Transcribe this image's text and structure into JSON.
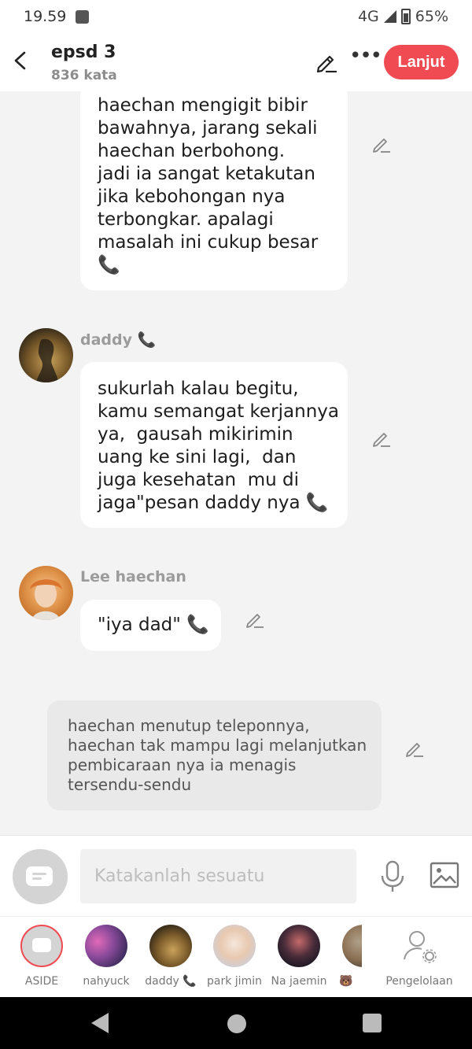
{
  "status_bar": {
    "time": "19.59",
    "network": "4G",
    "battery": "65%"
  },
  "header": {
    "title": "epsd 3",
    "word_count": "836 kata",
    "next_label": "Lanjut"
  },
  "messages": [
    {
      "lines": [
        "haechan mengigit bibir",
        "bawahnya, jarang sekali",
        "haechan berbohong.",
        "jadi ia sangat ketakutan",
        "jika kebohongan nya",
        "terbongkar. apalagi",
        "masalah ini cukup besar"
      ],
      "phone": "📞"
    },
    {
      "sender": "daddy",
      "sender_phone": "📞",
      "lines": [
        "sukurlah kalau begitu,",
        "kamu semangat kerjannya",
        "ya,  gausah mikirimin",
        "uang ke sini lagi,  dan",
        "juga kesehatan  mu di",
        "jaga\"pesan daddy nya"
      ],
      "phone": "📞"
    },
    {
      "sender": "Lee haechan",
      "lines": [
        "\"iya dad\""
      ],
      "phone": "📞"
    }
  ],
  "narration": {
    "lines": [
      "haechan menutup teleponnya,",
      "haechan tak mampu lagi melanjutkan",
      "pembicaraan nya ia menagis",
      "tersendu-sendu"
    ]
  },
  "input": {
    "placeholder": "Katakanlah sesuatu"
  },
  "characters": [
    {
      "label": "ASIDE"
    },
    {
      "label": "nahyuck"
    },
    {
      "label": "daddy 📞"
    },
    {
      "label": "park jimin"
    },
    {
      "label": "Na jaemin"
    },
    {
      "label": "🐻"
    },
    {
      "label": "Pengelolaan"
    }
  ],
  "colors": {
    "accent": "#f04a52",
    "bubble": "#ffffff",
    "narration": "#e9e9e9",
    "background": "#f3f3f3"
  }
}
